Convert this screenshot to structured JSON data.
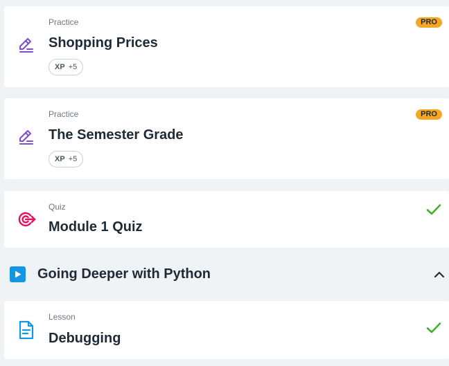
{
  "items": [
    {
      "type": "Practice",
      "title": "Shopping Prices",
      "xp_label": "XP",
      "xp_value": "+5",
      "badge": "PRO",
      "icon": "pencil-edit-icon"
    },
    {
      "type": "Practice",
      "title": "The Semester Grade",
      "xp_label": "XP",
      "xp_value": "+5",
      "badge": "PRO",
      "icon": "pencil-edit-icon"
    },
    {
      "type": "Quiz",
      "title": "Module 1 Quiz",
      "status": "completed",
      "icon": "target-icon"
    }
  ],
  "section": {
    "title": "Going Deeper with Python",
    "icon": "play-icon",
    "expanded": true
  },
  "section_items": [
    {
      "type": "Lesson",
      "title": "Debugging",
      "status": "completed",
      "icon": "document-icon"
    }
  ],
  "colors": {
    "background": "#f0f3f6",
    "pro_badge": "#f5a623",
    "check": "#43b02a",
    "practice_icon": "#7c4dcc",
    "quiz_icon": "#e3105f",
    "lesson_icon": "#1496e6",
    "section_icon": "#1496e6"
  }
}
